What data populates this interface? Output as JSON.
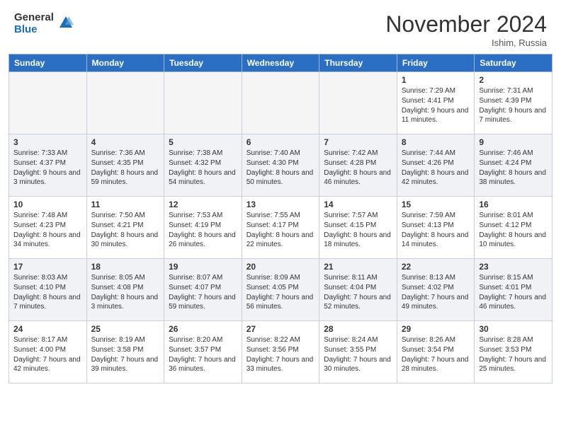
{
  "header": {
    "logo_general": "General",
    "logo_blue": "Blue",
    "month_year": "November 2024",
    "location": "Ishim, Russia"
  },
  "days_of_week": [
    "Sunday",
    "Monday",
    "Tuesday",
    "Wednesday",
    "Thursday",
    "Friday",
    "Saturday"
  ],
  "weeks": [
    [
      {
        "day": "",
        "empty": true
      },
      {
        "day": "",
        "empty": true
      },
      {
        "day": "",
        "empty": true
      },
      {
        "day": "",
        "empty": true
      },
      {
        "day": "",
        "empty": true
      },
      {
        "day": "1",
        "sunrise": "Sunrise: 7:29 AM",
        "sunset": "Sunset: 4:41 PM",
        "daylight": "Daylight: 9 hours and 11 minutes."
      },
      {
        "day": "2",
        "sunrise": "Sunrise: 7:31 AM",
        "sunset": "Sunset: 4:39 PM",
        "daylight": "Daylight: 9 hours and 7 minutes."
      }
    ],
    [
      {
        "day": "3",
        "sunrise": "Sunrise: 7:33 AM",
        "sunset": "Sunset: 4:37 PM",
        "daylight": "Daylight: 9 hours and 3 minutes."
      },
      {
        "day": "4",
        "sunrise": "Sunrise: 7:36 AM",
        "sunset": "Sunset: 4:35 PM",
        "daylight": "Daylight: 8 hours and 59 minutes."
      },
      {
        "day": "5",
        "sunrise": "Sunrise: 7:38 AM",
        "sunset": "Sunset: 4:32 PM",
        "daylight": "Daylight: 8 hours and 54 minutes."
      },
      {
        "day": "6",
        "sunrise": "Sunrise: 7:40 AM",
        "sunset": "Sunset: 4:30 PM",
        "daylight": "Daylight: 8 hours and 50 minutes."
      },
      {
        "day": "7",
        "sunrise": "Sunrise: 7:42 AM",
        "sunset": "Sunset: 4:28 PM",
        "daylight": "Daylight: 8 hours and 46 minutes."
      },
      {
        "day": "8",
        "sunrise": "Sunrise: 7:44 AM",
        "sunset": "Sunset: 4:26 PM",
        "daylight": "Daylight: 8 hours and 42 minutes."
      },
      {
        "day": "9",
        "sunrise": "Sunrise: 7:46 AM",
        "sunset": "Sunset: 4:24 PM",
        "daylight": "Daylight: 8 hours and 38 minutes."
      }
    ],
    [
      {
        "day": "10",
        "sunrise": "Sunrise: 7:48 AM",
        "sunset": "Sunset: 4:23 PM",
        "daylight": "Daylight: 8 hours and 34 minutes."
      },
      {
        "day": "11",
        "sunrise": "Sunrise: 7:50 AM",
        "sunset": "Sunset: 4:21 PM",
        "daylight": "Daylight: 8 hours and 30 minutes."
      },
      {
        "day": "12",
        "sunrise": "Sunrise: 7:53 AM",
        "sunset": "Sunset: 4:19 PM",
        "daylight": "Daylight: 8 hours and 26 minutes."
      },
      {
        "day": "13",
        "sunrise": "Sunrise: 7:55 AM",
        "sunset": "Sunset: 4:17 PM",
        "daylight": "Daylight: 8 hours and 22 minutes."
      },
      {
        "day": "14",
        "sunrise": "Sunrise: 7:57 AM",
        "sunset": "Sunset: 4:15 PM",
        "daylight": "Daylight: 8 hours and 18 minutes."
      },
      {
        "day": "15",
        "sunrise": "Sunrise: 7:59 AM",
        "sunset": "Sunset: 4:13 PM",
        "daylight": "Daylight: 8 hours and 14 minutes."
      },
      {
        "day": "16",
        "sunrise": "Sunrise: 8:01 AM",
        "sunset": "Sunset: 4:12 PM",
        "daylight": "Daylight: 8 hours and 10 minutes."
      }
    ],
    [
      {
        "day": "17",
        "sunrise": "Sunrise: 8:03 AM",
        "sunset": "Sunset: 4:10 PM",
        "daylight": "Daylight: 8 hours and 7 minutes."
      },
      {
        "day": "18",
        "sunrise": "Sunrise: 8:05 AM",
        "sunset": "Sunset: 4:08 PM",
        "daylight": "Daylight: 8 hours and 3 minutes."
      },
      {
        "day": "19",
        "sunrise": "Sunrise: 8:07 AM",
        "sunset": "Sunset: 4:07 PM",
        "daylight": "Daylight: 7 hours and 59 minutes."
      },
      {
        "day": "20",
        "sunrise": "Sunrise: 8:09 AM",
        "sunset": "Sunset: 4:05 PM",
        "daylight": "Daylight: 7 hours and 56 minutes."
      },
      {
        "day": "21",
        "sunrise": "Sunrise: 8:11 AM",
        "sunset": "Sunset: 4:04 PM",
        "daylight": "Daylight: 7 hours and 52 minutes."
      },
      {
        "day": "22",
        "sunrise": "Sunrise: 8:13 AM",
        "sunset": "Sunset: 4:02 PM",
        "daylight": "Daylight: 7 hours and 49 minutes."
      },
      {
        "day": "23",
        "sunrise": "Sunrise: 8:15 AM",
        "sunset": "Sunset: 4:01 PM",
        "daylight": "Daylight: 7 hours and 46 minutes."
      }
    ],
    [
      {
        "day": "24",
        "sunrise": "Sunrise: 8:17 AM",
        "sunset": "Sunset: 4:00 PM",
        "daylight": "Daylight: 7 hours and 42 minutes."
      },
      {
        "day": "25",
        "sunrise": "Sunrise: 8:19 AM",
        "sunset": "Sunset: 3:58 PM",
        "daylight": "Daylight: 7 hours and 39 minutes."
      },
      {
        "day": "26",
        "sunrise": "Sunrise: 8:20 AM",
        "sunset": "Sunset: 3:57 PM",
        "daylight": "Daylight: 7 hours and 36 minutes."
      },
      {
        "day": "27",
        "sunrise": "Sunrise: 8:22 AM",
        "sunset": "Sunset: 3:56 PM",
        "daylight": "Daylight: 7 hours and 33 minutes."
      },
      {
        "day": "28",
        "sunrise": "Sunrise: 8:24 AM",
        "sunset": "Sunset: 3:55 PM",
        "daylight": "Daylight: 7 hours and 30 minutes."
      },
      {
        "day": "29",
        "sunrise": "Sunrise: 8:26 AM",
        "sunset": "Sunset: 3:54 PM",
        "daylight": "Daylight: 7 hours and 28 minutes."
      },
      {
        "day": "30",
        "sunrise": "Sunrise: 8:28 AM",
        "sunset": "Sunset: 3:53 PM",
        "daylight": "Daylight: 7 hours and 25 minutes."
      }
    ]
  ]
}
